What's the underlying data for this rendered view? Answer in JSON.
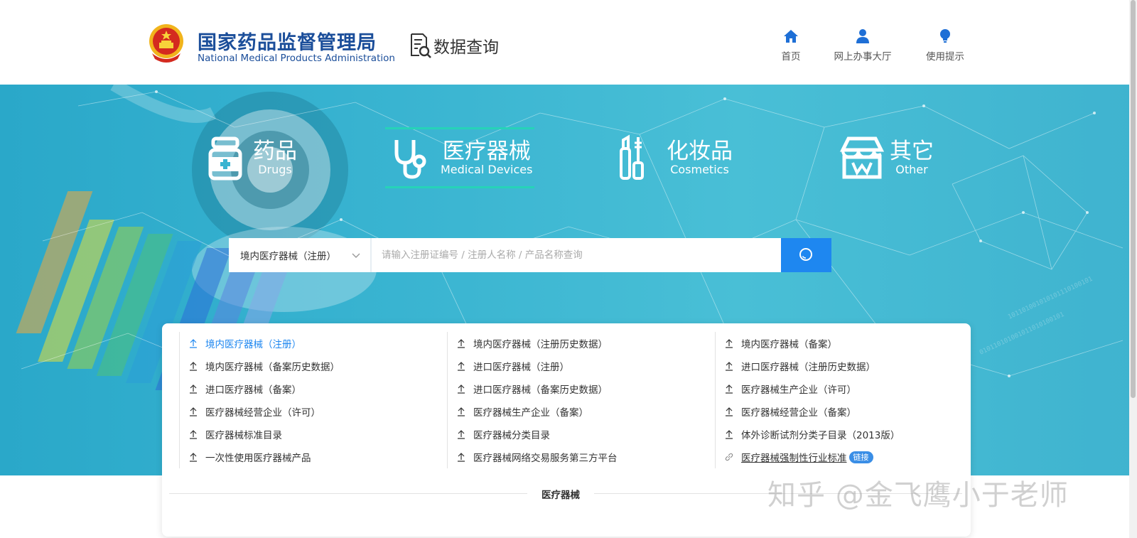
{
  "header": {
    "org_name_cn": "国家药品监督管理局",
    "org_name_en": "National Medical Products Administration",
    "data_query_label": "数据查询",
    "nav": [
      {
        "label": "首页",
        "icon": "home-icon"
      },
      {
        "label": "网上办事大厅",
        "icon": "user-icon"
      },
      {
        "label": "使用提示",
        "icon": "lightbulb-icon"
      }
    ]
  },
  "categories": [
    {
      "cn": "药品",
      "en": "Drugs",
      "icon": "drug-bottle-icon",
      "active": false
    },
    {
      "cn": "医疗器械",
      "en": "Medical Devices",
      "icon": "stethoscope-icon",
      "active": true
    },
    {
      "cn": "化妆品",
      "en": "Cosmetics",
      "icon": "cosmetics-icon",
      "active": false
    },
    {
      "cn": "其它",
      "en": "Other",
      "icon": "store-icon",
      "active": false
    }
  ],
  "search": {
    "selected": "境内医疗器械（注册）",
    "placeholder": "请输入注册证编号 / 注册人名称 / 产品名称查询"
  },
  "links": [
    {
      "label": "境内医疗器械（注册）",
      "active": true
    },
    {
      "label": "境内医疗器械（注册历史数据）"
    },
    {
      "label": "境内医疗器械（备案）"
    },
    {
      "label": "境内医疗器械（备案历史数据）"
    },
    {
      "label": "进口医疗器械（注册）"
    },
    {
      "label": "进口医疗器械（注册历史数据）"
    },
    {
      "label": "进口医疗器械（备案）"
    },
    {
      "label": "进口医疗器械（备案历史数据）"
    },
    {
      "label": "医疗器械生产企业（许可）"
    },
    {
      "label": "医疗器械经营企业（许可）"
    },
    {
      "label": "医疗器械生产企业（备案）"
    },
    {
      "label": "医疗器械经营企业（备案）"
    },
    {
      "label": "医疗器械标准目录"
    },
    {
      "label": "医疗器械分类目录"
    },
    {
      "label": "体外诊断试剂分类子目录（2013版）"
    },
    {
      "label": "一次性使用医疗器械产品"
    },
    {
      "label": "医疗器械网络交易服务第三方平台"
    },
    {
      "label": "医疗器械强制性行业标准",
      "link": true,
      "tag": "链接"
    }
  ],
  "panel": {
    "section_title": "医疗器械"
  },
  "watermark": "知乎 @金飞鹰小于老师",
  "colors": {
    "brand_blue": "#1b4e9a",
    "accent": "#1e87f0",
    "active_underline": "#26d3b8",
    "banner": "#39b4d1"
  }
}
